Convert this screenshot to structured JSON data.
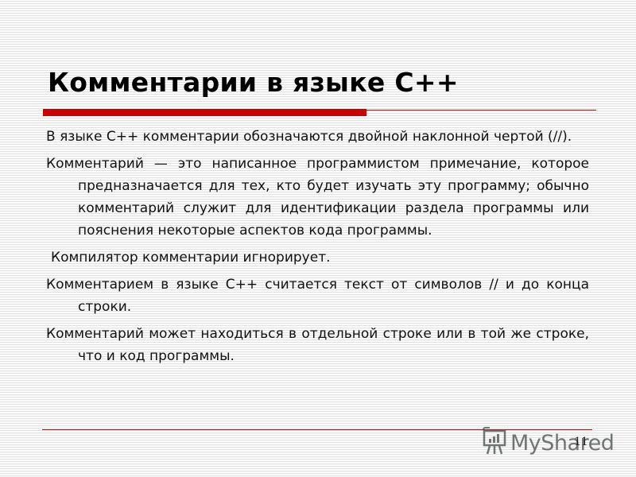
{
  "slide": {
    "title": "Комментарии в языке С++",
    "paragraphs": [
      "В языке С++ комментарии обозначаются двойной наклонной чертой (//).",
      "Комментарий — это написанное программистом примечание, которое предназначается для тех, кто будет изучать эту программу; обычно комментарий служит для идентификации раздела программы или пояснения некоторые аспектов кода программы.",
      "Компилятор комментарии игнорирует.",
      "Комментарием в языке С++ считается текст от символов // и до конца строки.",
      "Комментарий может находиться в отдельной строке или в той же строке, что и код программы."
    ],
    "page_number": "11"
  },
  "watermark": {
    "text": "MyShared",
    "icon": "presentation-board-icon"
  },
  "colors": {
    "accent": "#cc0000",
    "divider": "#6b2a2a",
    "text": "#111111"
  }
}
